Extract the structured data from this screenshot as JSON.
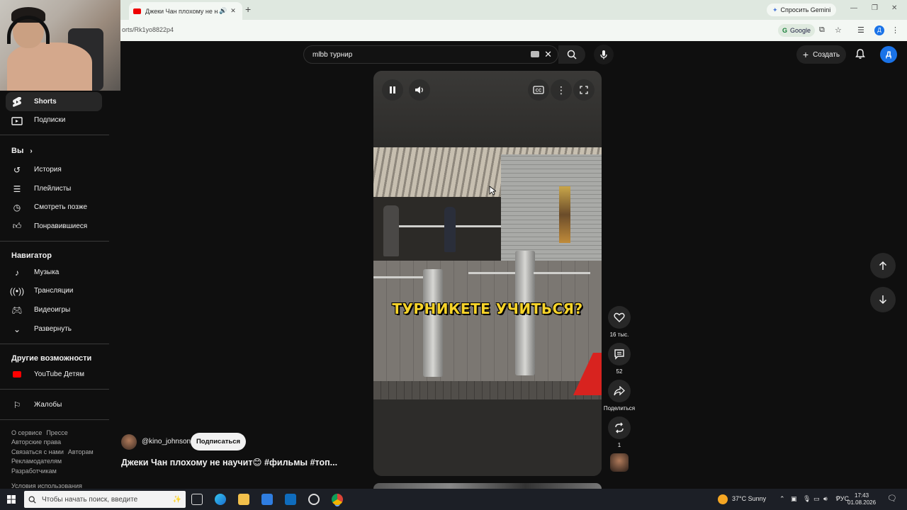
{
  "browser": {
    "tab_title": "Джеки Чан плохому не на",
    "url": "orts/Rk1yo8822p4",
    "gemini_label": "Спросить Gemini",
    "google_chip": "Google",
    "profile_letter": "Д"
  },
  "header": {
    "search_value": "mlbb турнир",
    "create_label": "Создать",
    "avatar_letter": "Д"
  },
  "sidebar": {
    "top_items": [
      {
        "label": "Shorts"
      },
      {
        "label": "Подписки"
      }
    ],
    "you_title": "Вы",
    "you_items": [
      {
        "label": "История"
      },
      {
        "label": "Плейлисты"
      },
      {
        "label": "Смотреть позже"
      },
      {
        "label": "Понравившиеся"
      }
    ],
    "navigator_title": "Навигатор",
    "navigator_items": [
      {
        "label": "Музыка"
      },
      {
        "label": "Трансляции"
      },
      {
        "label": "Видеоигры"
      },
      {
        "label": "Развернуть"
      }
    ],
    "more_title": "Другие возможности",
    "more_items": [
      {
        "label": "YouTube Детям"
      }
    ],
    "report_label": "Жалобы",
    "footer": {
      "line1a": "О сервисе",
      "line1b": "Прессе",
      "line2": "Авторские права",
      "line3a": "Связаться с нами",
      "line3b": "Авторам",
      "line4": "Рекламодателям",
      "line5": "Разработчикам",
      "line6": "Условия использования"
    }
  },
  "video": {
    "subtitle": "ТУРНИКЕТЕ УЧИТЬСЯ?",
    "channel": "@kino_johnson",
    "subscribe_label": "Подписаться",
    "title": "Джеки Чан плохому не научит😊 #фильмы #топ..."
  },
  "actions": {
    "likes": "16 тыс.",
    "comments": "52",
    "share_label": "Поделиться",
    "remix_count": "1"
  },
  "taskbar": {
    "search_placeholder": "Чтобы начать поиск, введите",
    "weather": "37°C Sunny",
    "lang": "РУС",
    "time": "17:43",
    "date": "01.08.2026"
  },
  "colors": {
    "background": "#0f0f0f",
    "youtube_red": "#ff0000",
    "subtitle_yellow": "#f6d32a",
    "avatar_blue": "#1a73e8"
  }
}
